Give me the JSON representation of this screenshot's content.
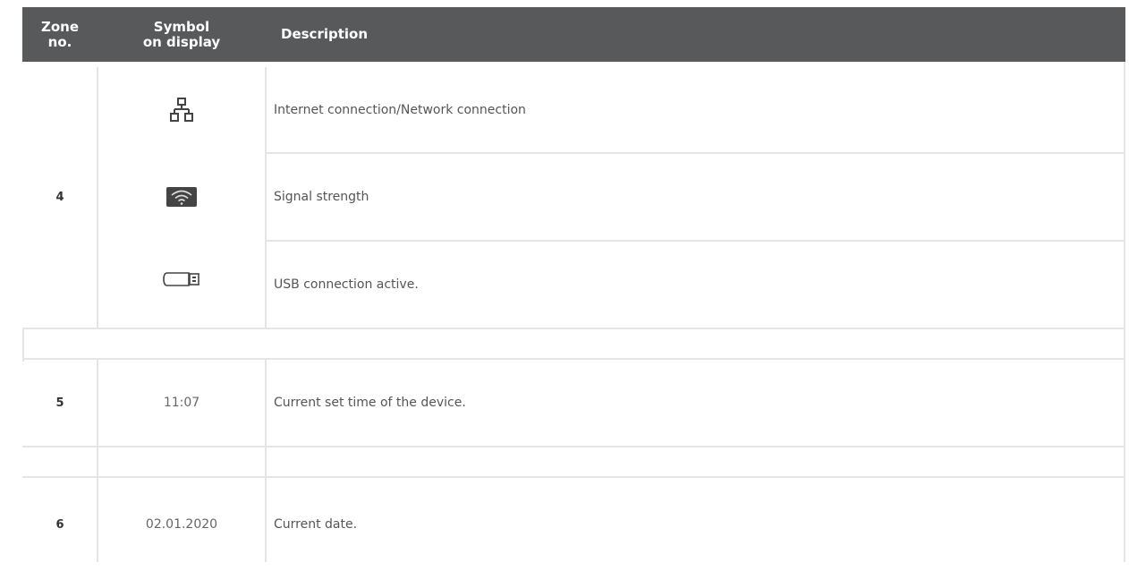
{
  "header": {
    "zone_label": "Zone no.",
    "symbol_label": "Symbol on display",
    "description_label": "Description"
  },
  "rows": [
    {
      "zone": "4",
      "symbol_icon": "network-icon",
      "description": "Internet connection/Network connection"
    },
    {
      "zone": "",
      "symbol_icon": "wifi-signal-icon",
      "description": "Signal strength"
    },
    {
      "zone": "",
      "symbol_icon": "usb-stick-icon",
      "description": "USB connection active."
    },
    {
      "zone": "5",
      "symbol_text": "11:07",
      "description": "Current set time of the device."
    },
    {
      "zone": "6",
      "symbol_text": "02.01.2020",
      "description": "Current date."
    }
  ],
  "colors": {
    "header_bg": "#58595b",
    "header_text": "#ffffff",
    "grid_line": "#e5e5e5",
    "body_text": "#555555"
  }
}
